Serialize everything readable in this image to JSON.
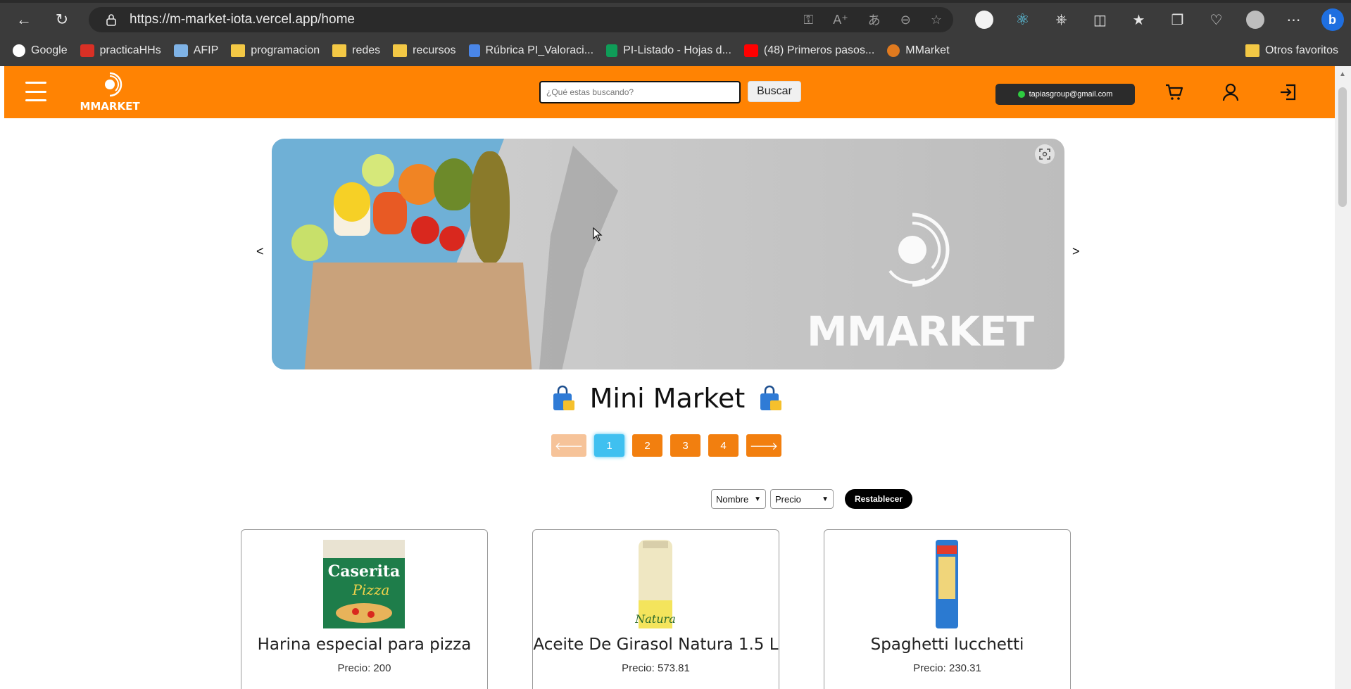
{
  "browser": {
    "url": "https://m-market-iota.vercel.app/home",
    "bookmarks": [
      {
        "label": "Google",
        "icon": "google-icon"
      },
      {
        "label": "practicaHHs",
        "icon": "gmail-icon"
      },
      {
        "label": "AFIP",
        "icon": "afip-icon"
      },
      {
        "label": "programacion",
        "icon": "folder-icon"
      },
      {
        "label": "redes",
        "icon": "folder-icon"
      },
      {
        "label": "recursos",
        "icon": "folder-icon"
      },
      {
        "label": "Rúbrica PI_Valoraci...",
        "icon": "docs-icon"
      },
      {
        "label": "PI-Listado - Hojas d...",
        "icon": "sheets-icon"
      },
      {
        "label": "(48) Primeros pasos...",
        "icon": "youtube-icon"
      },
      {
        "label": "MMarket",
        "icon": "mmarket-icon"
      }
    ],
    "other_favorites": "Otros favoritos"
  },
  "header": {
    "logo_text": "MMARKET",
    "search_placeholder": "¿Qué estas buscando?",
    "search_button": "Buscar",
    "user_email": "tapiasgroup@gmail.com"
  },
  "carousel": {
    "logo_text": "MMARKET",
    "prev": "<",
    "next": ">"
  },
  "title": "Mini Market",
  "pagination": {
    "pages": [
      "1",
      "2",
      "3",
      "4"
    ],
    "active": "1",
    "prev_icon": "🡐",
    "next_icon": "🡒"
  },
  "filters": {
    "sort_name": "Nombre",
    "sort_price": "Precio",
    "reset": "Restablecer"
  },
  "products": [
    {
      "name": "Harina especial para pizza",
      "price": "Precio: 200"
    },
    {
      "name": "Aceite De Girasol Natura 1.5 L",
      "price": "Precio: 573.81"
    },
    {
      "name": "Spaghetti lucchetti",
      "price": "Precio: 230.31"
    }
  ],
  "colors": {
    "brand_orange": "#ff8303",
    "pager_active": "#3fc0f0",
    "chrome_dark": "#3b3b3b"
  }
}
